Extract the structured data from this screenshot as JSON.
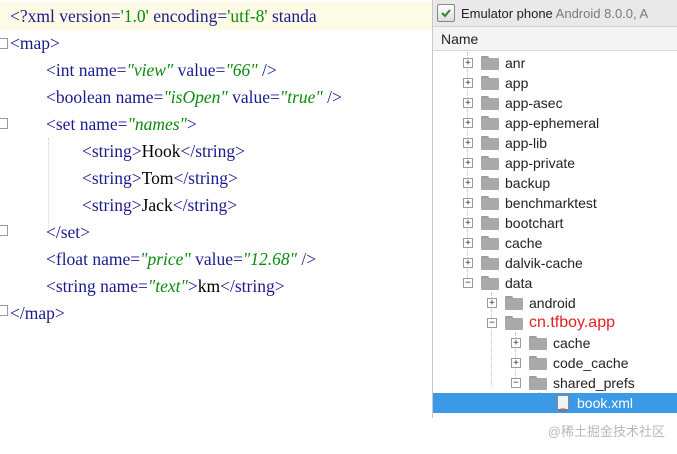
{
  "editor": {
    "xml_decl": {
      "open": "<?xml ",
      "version_attr": "version=",
      "version_val": "'1.0'",
      "encoding_attr": " encoding=",
      "encoding_val": "'utf-8'",
      "standalone_partial": " standa"
    },
    "lines": {
      "map_open": "<map>",
      "int_tag": "<int ",
      "int_name_attr": "name=",
      "int_name_val": "\"view\"",
      "int_value_attr": " value=",
      "int_value_val": "\"66\"",
      "int_close": " />",
      "bool_tag": "<boolean ",
      "bool_name_attr": "name=",
      "bool_name_val": "\"isOpen\"",
      "bool_value_attr": " value=",
      "bool_value_val": "\"true\"",
      "bool_close": " />",
      "set_tag": "<set ",
      "set_name_attr": "name=",
      "set_name_val": "\"names\"",
      "set_close": ">",
      "str1_open": "<string>",
      "str1_text": "Hook",
      "str1_close": "</string>",
      "str2_open": "<string>",
      "str2_text": "Tom",
      "str2_close": "</string>",
      "str3_open": "<string>",
      "str3_text": "Jack",
      "str3_close": "</string>",
      "set_end": "</set>",
      "float_tag": "<float ",
      "float_name_attr": "name=",
      "float_name_val": "\"price\"",
      "float_value_attr": " value=",
      "float_value_val": "\"12.68\"",
      "float_close": " />",
      "string_tag": "<string ",
      "string_name_attr": "name=",
      "string_name_val": "\"text\"",
      "string_close": ">",
      "string_text": "km",
      "string_end": "</string>",
      "map_end": "</map>"
    }
  },
  "explorer": {
    "title_device": "Emulator phone",
    "title_os": " Android 8.0.0, A",
    "column_header": "Name",
    "items": [
      {
        "label": "anr"
      },
      {
        "label": "app"
      },
      {
        "label": "app-asec"
      },
      {
        "label": "app-ephemeral"
      },
      {
        "label": "app-lib"
      },
      {
        "label": "app-private"
      },
      {
        "label": "backup"
      },
      {
        "label": "benchmarktest"
      },
      {
        "label": "bootchart"
      },
      {
        "label": "cache"
      },
      {
        "label": "dalvik-cache"
      },
      {
        "label": "data"
      },
      {
        "label": "android"
      },
      {
        "label": "cn.tfboy.app"
      },
      {
        "label": "cache"
      },
      {
        "label": "code_cache"
      },
      {
        "label": "shared_prefs"
      },
      {
        "label": "book.xml"
      }
    ]
  },
  "watermark": "@稀土掘金技术社区",
  "colors": {
    "selection": "#3c99e6",
    "highlight_label": "#e02222",
    "xml_tag": "#1b1b8f",
    "xml_value": "#0b8a0b"
  }
}
